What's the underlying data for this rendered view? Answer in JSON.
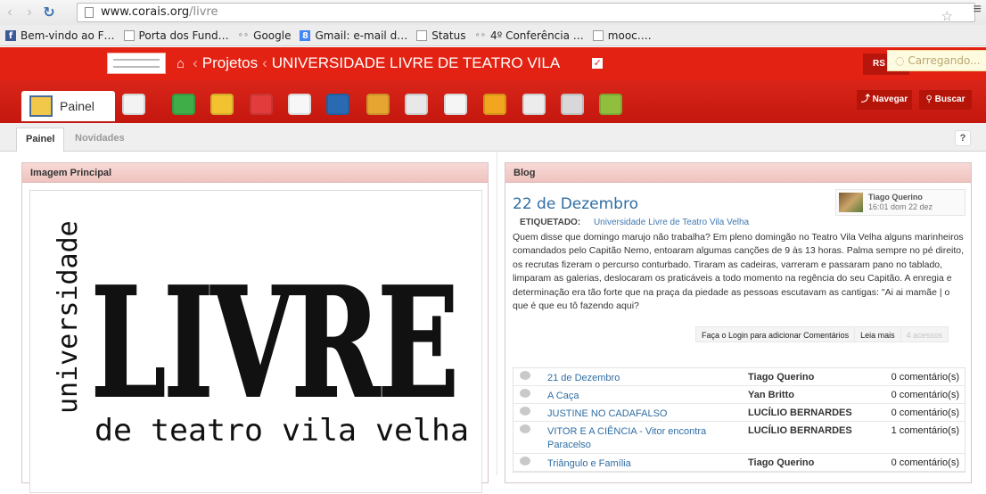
{
  "browser": {
    "url_domain": "www.corais.org",
    "url_path": "/livre",
    "bookmarks": [
      {
        "label": "Bem-vindo ao F…",
        "icon": "facebook-icon"
      },
      {
        "label": "Porta dos Fund…",
        "icon": "page-icon"
      },
      {
        "label": "Google",
        "icon": "glasses-icon"
      },
      {
        "label": "Gmail: e-mail d…",
        "icon": "gmail-icon"
      },
      {
        "label": "Status",
        "icon": "page-icon"
      },
      {
        "label": "4º Conferência …",
        "icon": "glasses-icon"
      },
      {
        "label": "mooc….",
        "icon": "page-icon"
      }
    ]
  },
  "header": {
    "crumb_projects": "Projetos",
    "crumb_current": "UNIVERSIDADE LIVRE DE TEATRO VILA",
    "rss": "RS",
    "loading": "Carregando..."
  },
  "toolbar": {
    "painel_label": "Painel",
    "navegar": "Navegar",
    "buscar": "Buscar",
    "tool_colors": [
      "#f3f3f3",
      "#3fae49",
      "#f2c230",
      "#e23c3c",
      "#f7f7f7",
      "#2a6ab3",
      "#e5a530",
      "#e8e8e8",
      "#f5f5f5",
      "#f2a51e",
      "#ececec",
      "#d8d8d8",
      "#8fbf3d"
    ]
  },
  "tabs": {
    "painel": "Painel",
    "novidades": "Novidades",
    "help": "?"
  },
  "left_panel": {
    "title": "Imagem Principal",
    "image_side": "universidade",
    "image_main": "LIVRE",
    "image_sub": "de teatro vila velha"
  },
  "blog": {
    "title": "Blog",
    "post": {
      "title": "22 de Dezembro",
      "author": "Tiago Querino",
      "time": "16:01 dom 22 dez",
      "tag_label": "ETIQUETADO:",
      "tag_value": "Universidade Livre de Teatro Vila Velha",
      "body": "Quem disse que domingo marujo não trabalha? Em pleno domingão no Teatro Vila Velha alguns marinheiros comandados pelo Capitão Nemo, entoaram algumas canções de 9 às 13 horas. Palma sempre no pé direito, os recrutas fizeram o percurso conturbado. Tiraram as cadeiras, varreram e passaram pano no tablado, limparam as galerias, deslocaram os praticáveis a todo momento na regência do seu Capitão. A enregia e determinação era tão forte que na praça da piedade as pessoas escutavam as cantigas: \"Ai ai mamãe | o que é que eu tô fazendo aqui?",
      "login_comment": "Faça o Login para adicionar Comentários",
      "read_more": "Leia mais",
      "views": "4 acessos"
    },
    "list": [
      {
        "title": "21 de Dezembro",
        "author": "Tiago Querino",
        "comments": "0 comentário(s)"
      },
      {
        "title": "A Caça",
        "author": "Yan Britto",
        "comments": "0 comentário(s)"
      },
      {
        "title": "JUSTINE NO CADAFALSO",
        "author": "LUCÍLIO BERNARDES",
        "comments": "0 comentário(s)"
      },
      {
        "title": "VITOR E A CIÊNCIA - Vitor encontra Paracelso",
        "author": "LUCÍLIO BERNARDES",
        "comments": "1 comentário(s)"
      },
      {
        "title": "Triângulo e Família",
        "author": "Tiago Querino",
        "comments": "0 comentário(s)"
      }
    ]
  }
}
